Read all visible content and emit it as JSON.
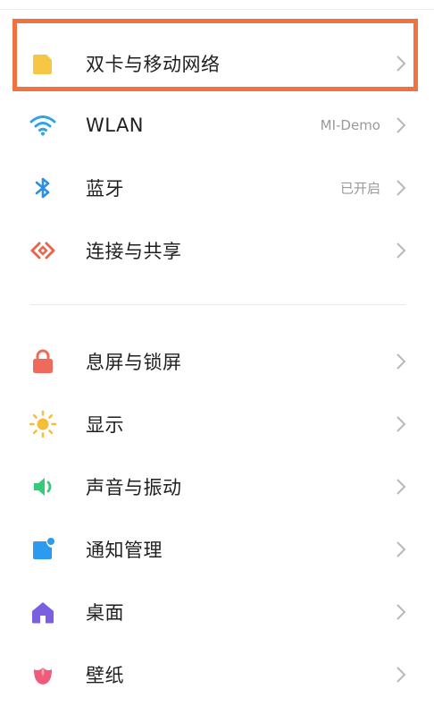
{
  "colors": {
    "highlight": "#f0723e",
    "text": "#1f1f1f",
    "secondary": "#9a9a9a"
  },
  "settings": {
    "items": [
      {
        "label": "双卡与移动网络",
        "value": "",
        "icon": "sim-card-icon"
      },
      {
        "label": "WLAN",
        "value": "MI-Demo",
        "icon": "wifi-icon"
      },
      {
        "label": "蓝牙",
        "value": "已开启",
        "icon": "bluetooth-icon"
      },
      {
        "label": "连接与共享",
        "value": "",
        "icon": "connection-share-icon"
      },
      {
        "label": "息屏与锁屏",
        "value": "",
        "icon": "lock-icon"
      },
      {
        "label": "显示",
        "value": "",
        "icon": "sun-icon"
      },
      {
        "label": "声音与振动",
        "value": "",
        "icon": "speaker-icon"
      },
      {
        "label": "通知管理",
        "value": "",
        "icon": "notification-icon"
      },
      {
        "label": "桌面",
        "value": "",
        "icon": "home-icon"
      },
      {
        "label": "壁纸",
        "value": "",
        "icon": "wallpaper-flower-icon"
      }
    ]
  }
}
